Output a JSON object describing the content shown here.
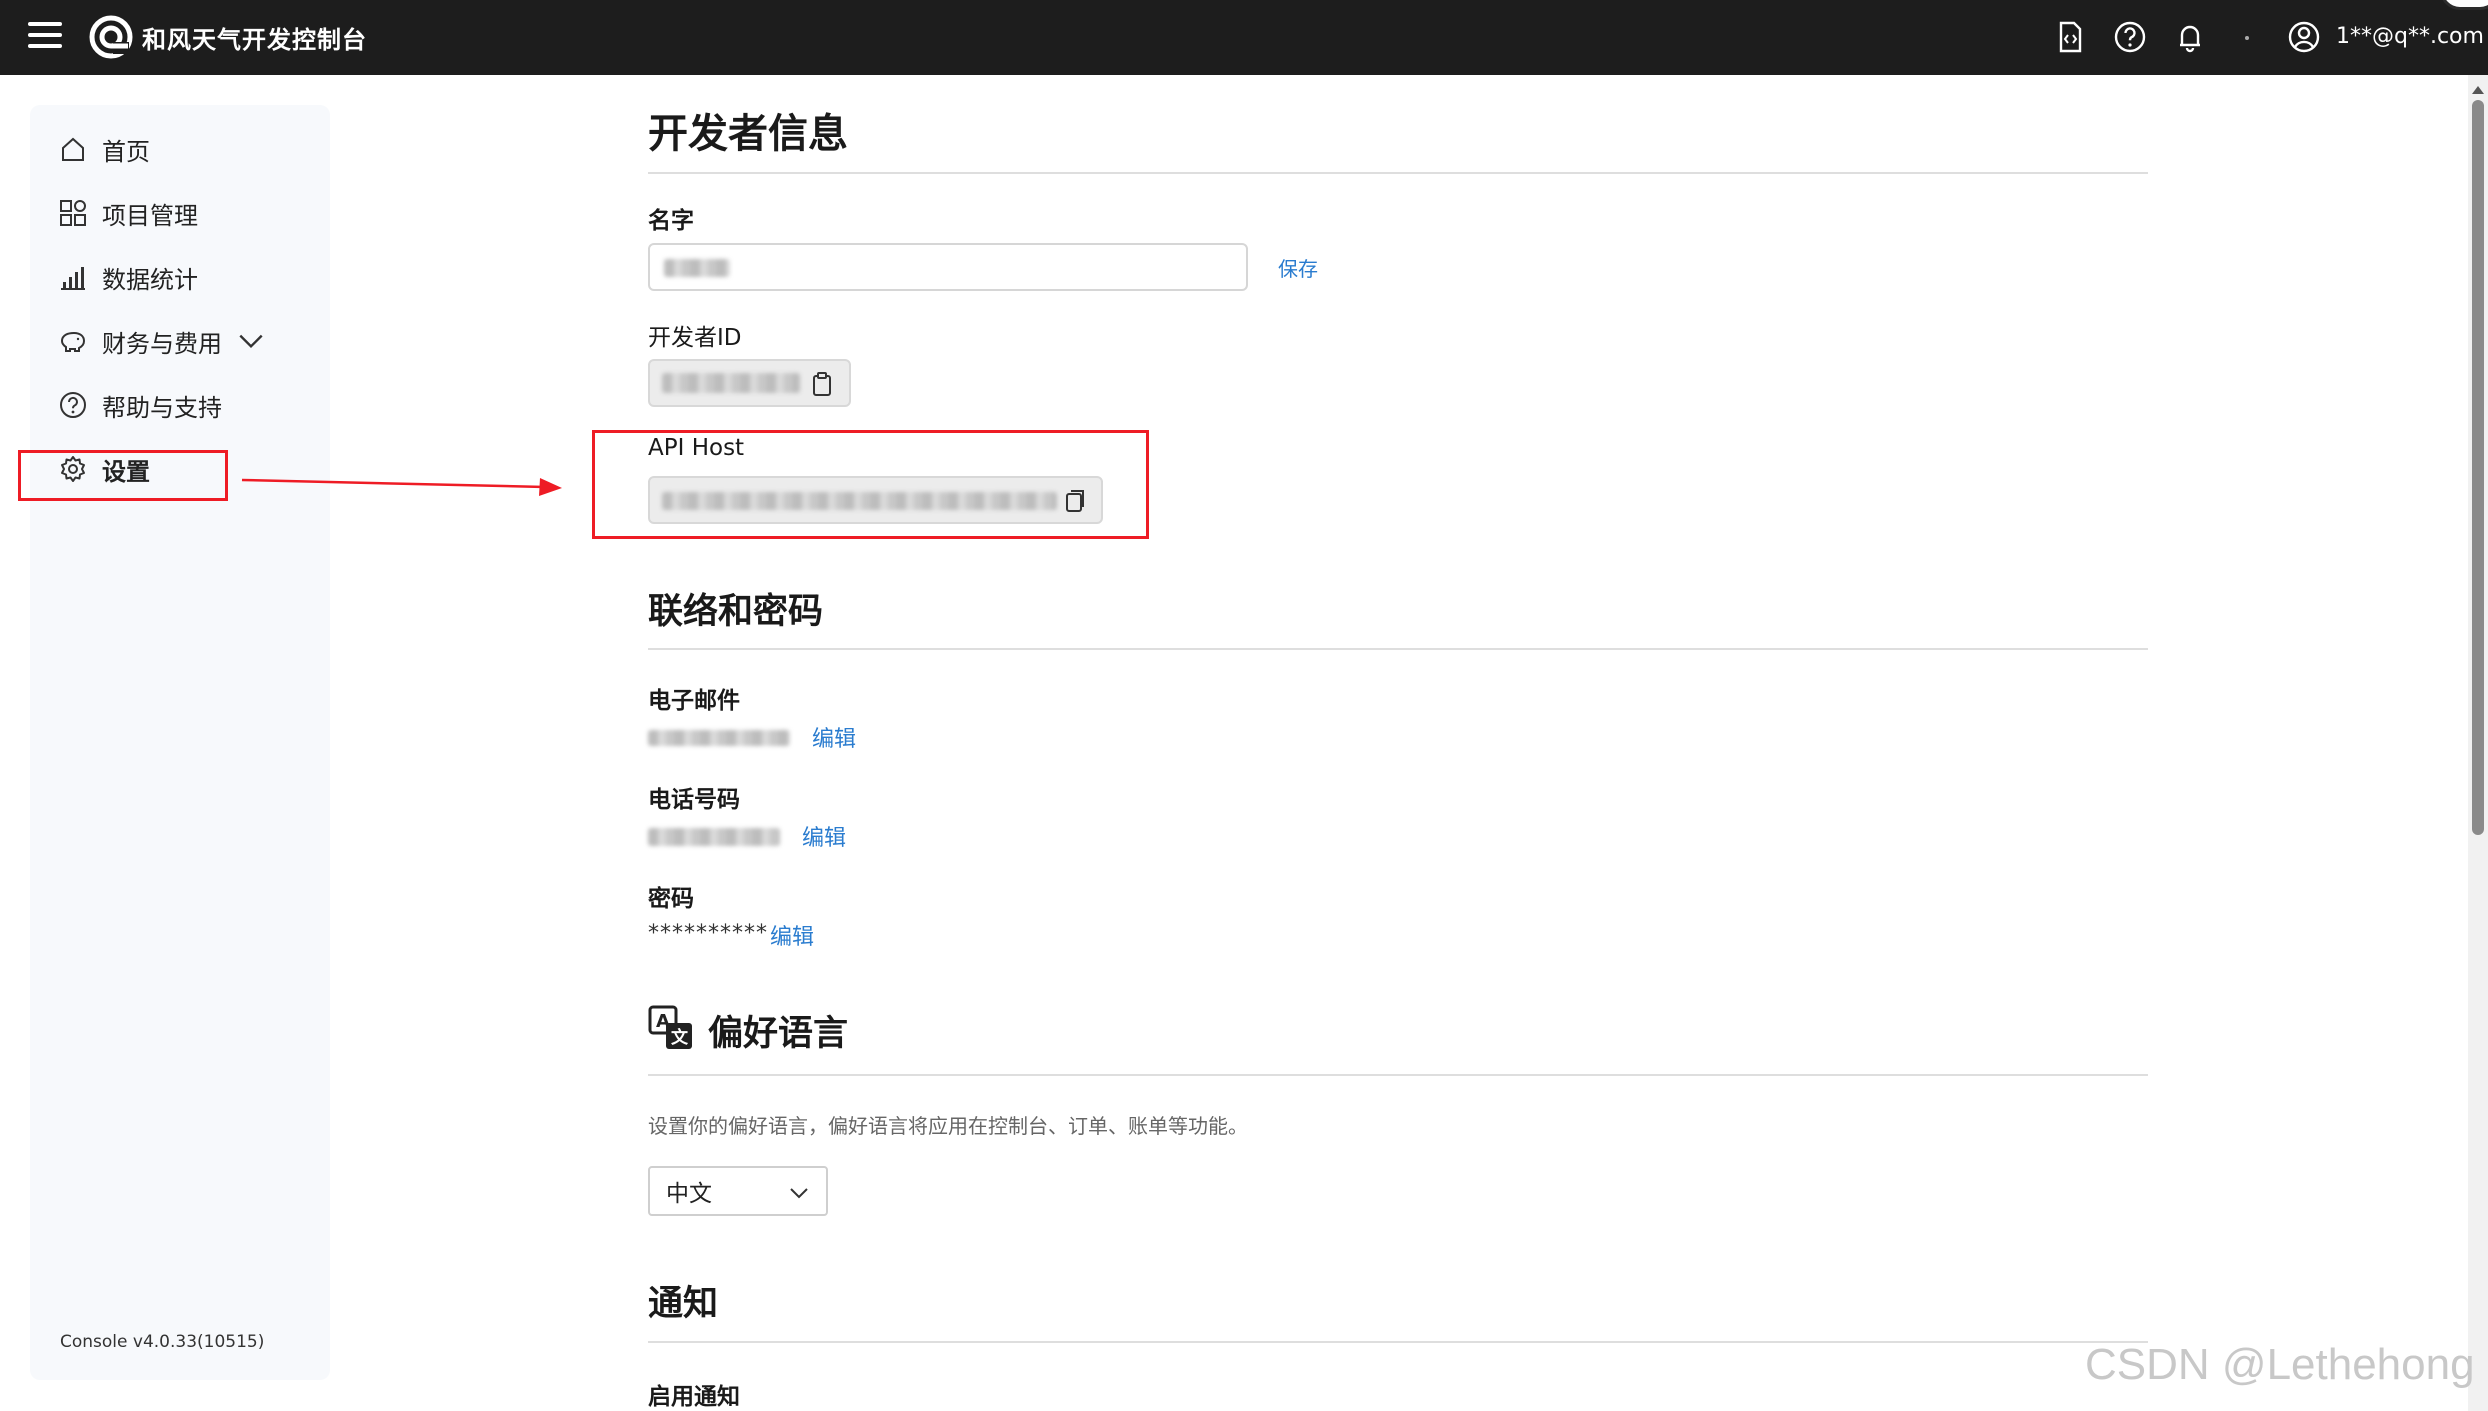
{
  "header": {
    "title": "和风天气开发控制台",
    "user_email": "1**@q**.com"
  },
  "sidebar": {
    "items": [
      {
        "label": "首页",
        "icon": "home-icon"
      },
      {
        "label": "项目管理",
        "icon": "grid-icon"
      },
      {
        "label": "数据统计",
        "icon": "bar-chart-icon"
      },
      {
        "label": "财务与费用",
        "icon": "piggy-bank-icon"
      },
      {
        "label": "帮助与支持",
        "icon": "help-circle-icon"
      },
      {
        "label": "设置",
        "icon": "gear-icon"
      }
    ],
    "version": "Console v4.0.33(10515)"
  },
  "developer": {
    "title": "开发者信息",
    "name_label": "名字",
    "save_label": "保存",
    "id_label": "开发者ID",
    "host_label": "API Host"
  },
  "contact": {
    "title": "联络和密码",
    "email_label": "电子邮件",
    "phone_label": "电话号码",
    "password_label": "密码",
    "password_mask": "**********",
    "edit_label": "编辑"
  },
  "language": {
    "title": "偏好语言",
    "hint": "设置你的偏好语言，偏好语言将应用在控制台、订单、账单等功能。",
    "selected": "中文"
  },
  "notify": {
    "title": "通知",
    "enable_label": "启用通知"
  },
  "watermark": "CSDN @Lethehong",
  "colors": {
    "topbar": "#1d1d1d",
    "link": "#2a7ccf",
    "annotation": "#ee1c25"
  }
}
